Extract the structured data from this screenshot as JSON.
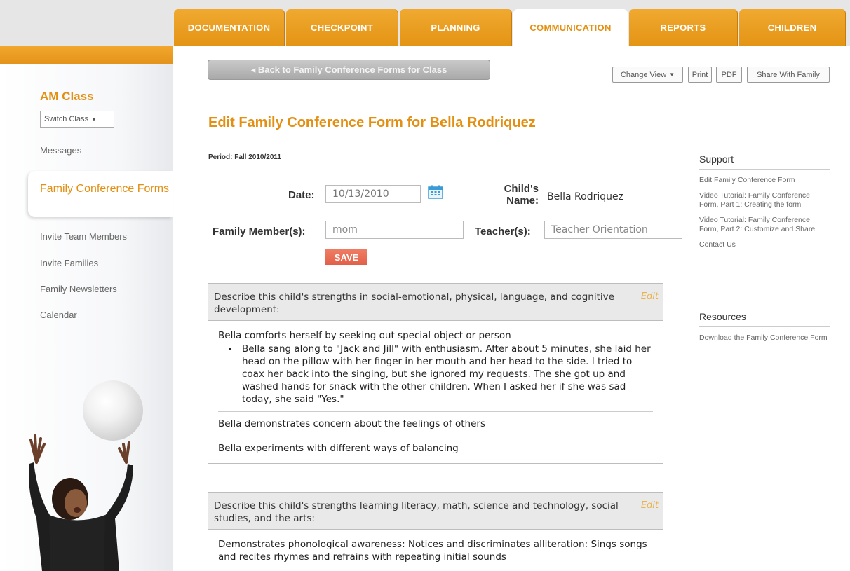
{
  "nav": {
    "tabs": [
      {
        "label": "DOCUMENTATION"
      },
      {
        "label": "CHECKPOINT"
      },
      {
        "label": "PLANNING"
      },
      {
        "label": "COMMUNICATION"
      },
      {
        "label": "REPORTS"
      },
      {
        "label": "CHILDREN"
      }
    ],
    "active_tab": "COMMUNICATION"
  },
  "sidebar": {
    "class_name": "AM Class",
    "switch_class_label": "Switch Class",
    "items": [
      {
        "label": "Messages"
      },
      {
        "label": "Family Conference Forms"
      },
      {
        "label": "Invite Team Members"
      },
      {
        "label": "Invite Families"
      },
      {
        "label": "Family Newsletters"
      },
      {
        "label": "Calendar"
      }
    ],
    "active_item": "Family Conference Forms"
  },
  "toolbar": {
    "back_label": "◂ Back to Family Conference Forms for Class",
    "change_view_label": "Change View",
    "print_label": "Print",
    "pdf_label": "PDF",
    "share_label": "Share With Family"
  },
  "form": {
    "title": "Edit Family Conference Form for Bella Rodriquez",
    "period": "Period: Fall 2010/2011",
    "date_label": "Date:",
    "date_value": "10/13/2010",
    "child_name_label_1": "Child's",
    "child_name_label_2": "Name:",
    "child_name_value": "Bella Rodriquez",
    "family_label": "Family Member(s):",
    "family_value": "mom",
    "teacher_label": "Teacher(s):",
    "teacher_value": "Teacher Orientation",
    "save_label": "SAVE"
  },
  "sections": [
    {
      "question": "Describe this child's strengths in social-emotional, physical, language, and cognitive development:",
      "edit_label": "Edit",
      "entries": [
        {
          "text": "Bella comforts herself by seeking out special object or person",
          "note": "Bella sang along to \"Jack and Jill\" with enthusiasm. After about 5 minutes, she laid her head on the pillow with her finger in her mouth and her head to the side. I tried to coax her back into the singing, but she ignored my requests. The she got up and washed hands for snack with the other children. When I asked her if she was sad today, she said \"Yes.\""
        },
        {
          "text": "Bella demonstrates concern about the feelings of others"
        },
        {
          "text": "Bella experiments with different ways of balancing"
        }
      ]
    },
    {
      "question": "Describe this child's strengths learning literacy, math, science and technology, social studies, and the arts:",
      "edit_label": "Edit",
      "entries": [
        {
          "text": "Demonstrates phonological awareness: Notices and discriminates alliteration: Sings songs and recites rhymes and refrains with repeating initial sounds"
        }
      ]
    }
  ],
  "support": {
    "title": "Support",
    "links": [
      "Edit Family Conference Form",
      "Video Tutorial: Family Conference Form, Part 1: Creating the form",
      "Video Tutorial: Family Conference Form, Part 2: Customize and Share",
      "Contact Us"
    ]
  },
  "resources": {
    "title": "Resources",
    "links": [
      "Download the Family Conference Form"
    ]
  },
  "colors": {
    "brand_orange": "#e38f12",
    "tab_orange": "#f0a930",
    "save_red": "#e26049"
  }
}
